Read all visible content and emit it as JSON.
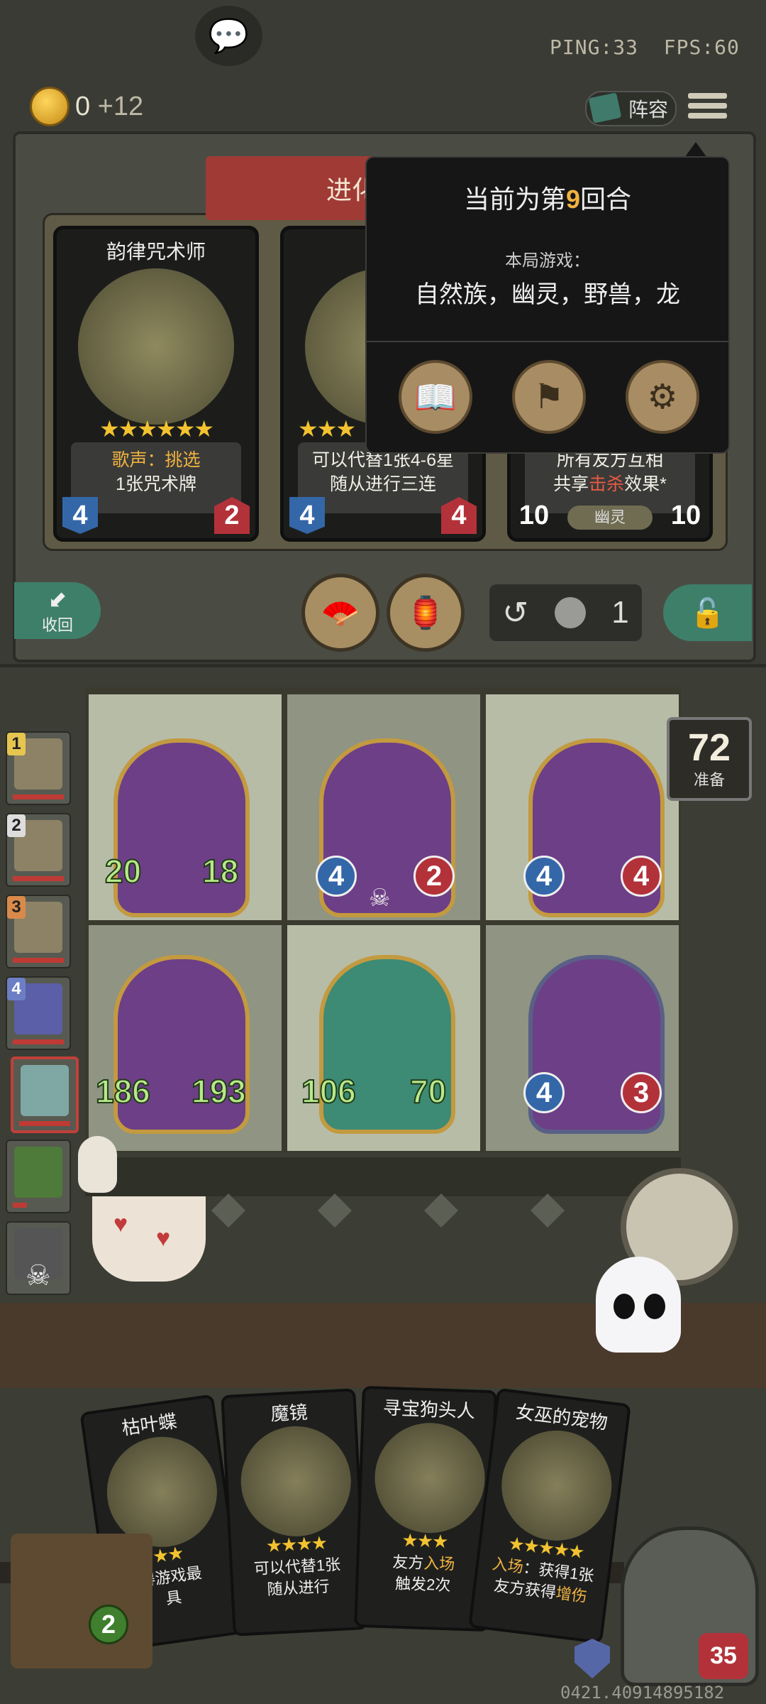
{
  "hud": {
    "ping": "PING:33",
    "fps": "FPS:60",
    "gold": "0",
    "gold_income": "+12",
    "lineup_label": "阵容"
  },
  "banner": {
    "text": "进化"
  },
  "offer_cards": [
    {
      "name": "韵律咒术师",
      "stars": "★★★★★★",
      "desc_prefix": "歌声：",
      "desc_hl": "挑选",
      "desc_line2": "1张咒术牌",
      "atk": "4",
      "hp": "2",
      "tribe": ""
    },
    {
      "name": "",
      "stars": "★★★",
      "desc_line1": "可以代替1张4-6星",
      "desc_line2": "随从进行三连",
      "atk": "4",
      "hp": "4",
      "tribe": ""
    },
    {
      "name": "",
      "stars": "",
      "desc_line1": "所有友方互相",
      "desc_pre2": "共享",
      "desc_hl": "击杀",
      "desc_post2": "效果*",
      "atk": "10",
      "hp": "10",
      "tribe": "幽灵"
    }
  ],
  "popup": {
    "round_pre": "当前为第",
    "round_num": "9",
    "round_post": "回合",
    "game_label": "本局游戏：",
    "tribes": "自然族，幽灵，野兽，龙",
    "buttons": [
      {
        "icon": "rulebook-icon"
      },
      {
        "icon": "surrender-flag-icon"
      },
      {
        "icon": "gear-icon"
      }
    ]
  },
  "controls": {
    "recall_label": "收回",
    "refresh_cost": "1"
  },
  "timer": {
    "value": "72",
    "label": "准备"
  },
  "players": [
    {
      "rank": "1",
      "dead": false,
      "self": false
    },
    {
      "rank": "2",
      "dead": false,
      "self": false
    },
    {
      "rank": "3",
      "dead": false,
      "self": false
    },
    {
      "rank": "4",
      "dead": false,
      "self": false
    },
    {
      "rank": "",
      "dead": false,
      "self": true
    },
    {
      "rank": "",
      "dead": false,
      "self": false
    },
    {
      "rank": "",
      "dead": true,
      "self": false
    },
    {
      "rank": "",
      "dead": true,
      "self": false
    }
  ],
  "board_minions": [
    {
      "atk": "20",
      "hp": "18",
      "style": "gold",
      "big": true
    },
    {
      "atk": "4",
      "hp": "2",
      "style": "gold",
      "big": false
    },
    {
      "atk": "4",
      "hp": "4",
      "style": "gold",
      "big": false
    },
    {
      "atk": "186",
      "hp": "193",
      "style": "gold",
      "big": true
    },
    {
      "atk": "106",
      "hp": "70",
      "style": "gold",
      "big": true
    },
    {
      "atk": "4",
      "hp": "3",
      "style": "blue",
      "big": false
    }
  ],
  "hand_cards": [
    {
      "name": "枯叶蝶",
      "stars": "★★",
      "desc1": "得游戏最",
      "desc2": "具"
    },
    {
      "name": "魔镜",
      "stars": "★★★★",
      "desc1": "可以代替1张",
      "desc2": "随从进行"
    },
    {
      "name": "寻宝狗头人",
      "stars": "★★★",
      "desc1_pre": "友方",
      "desc1_hl": "入场",
      "desc2": "触发2次"
    },
    {
      "name": "女巫的宠物",
      "stars": "★★★★★",
      "desc1_hl": "入场",
      "desc1_post": "：获得1张",
      "desc2_pre": "友方获得",
      "desc2_hl": "增伤"
    }
  ],
  "tavern_tier": "2",
  "hero_hp": "35",
  "build": "0421.40914895182"
}
